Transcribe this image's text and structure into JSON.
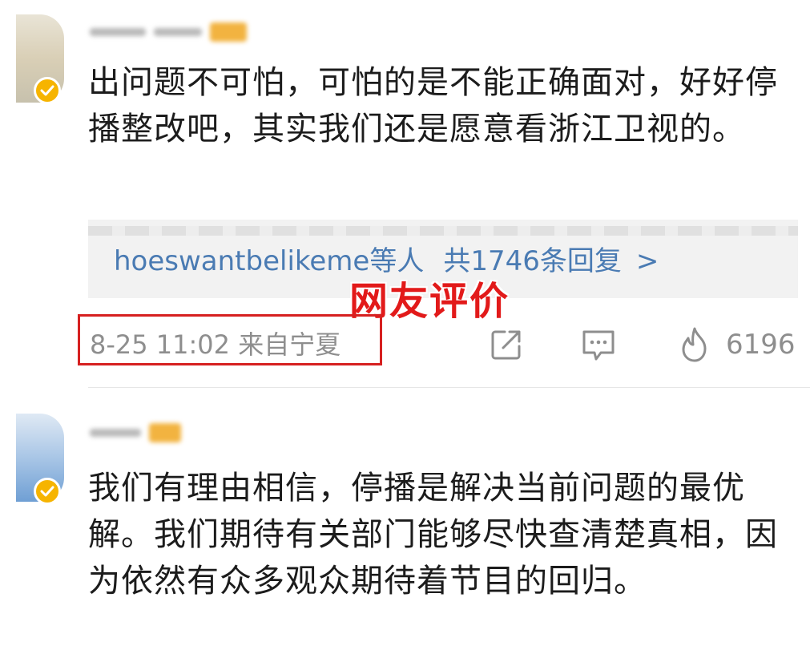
{
  "comments": [
    {
      "text": "出问题不可怕，可怕的是不能正确面对，好好停播整改吧，其实我们还是愿意看浙江卫视的。",
      "reply_summary": {
        "user": "hoeswantbelikeme",
        "suffix": "等人",
        "count_text": "共1746条回复",
        "arrow": ">"
      },
      "meta": "8-25 11:02 来自宁夏",
      "actions": {
        "share_icon": "share-icon",
        "comment_icon": "comment-icon",
        "like_icon": "flame-icon",
        "like_count": "6196"
      }
    },
    {
      "text": "我们有理由相信，停播是解决当前问题的最优解。我们期待有关部门能够尽快查清楚真相，因为依然有众多观众期待着节目的回归。"
    }
  ],
  "overlay_label": "网友评价",
  "colors": {
    "link": "#4a7bb3",
    "meta": "#8e8e8e",
    "highlight": "#d62020",
    "verified": "#f6b400"
  }
}
